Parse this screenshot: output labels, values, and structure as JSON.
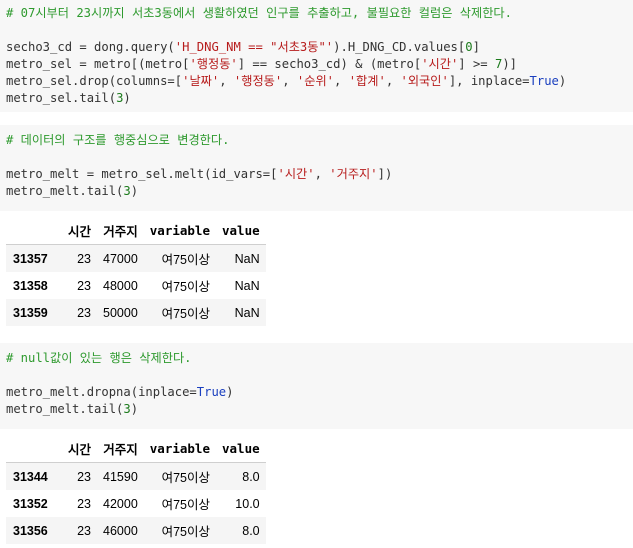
{
  "cell1": {
    "comment": "# 07시부터 23시까지 서초3동에서 생활하였던 인구를 추출하고, 불필요한 컬럼은 삭제한다.",
    "line1_a": "secho3_cd = dong.query(",
    "line1_str": "'H_DNG_NM == \"서초3동\"'",
    "line1_b": ").H_DNG_CD.values[",
    "line1_num": "0",
    "line1_c": "]",
    "line2_a": "metro_sel = metro[(metro[",
    "line2_str1": "'행정동'",
    "line2_b": "] == secho3_cd) & (metro[",
    "line2_str2": "'시간'",
    "line2_c": "] >= ",
    "line2_num": "7",
    "line2_d": ")]",
    "line3_a": "metro_sel.drop(columns=[",
    "line3_s1": "'날짜'",
    "line3_s2": "'행정동'",
    "line3_s3": "'순위'",
    "line3_s4": "'합계'",
    "line3_s5": "'외국인'",
    "line3_b": "], inplace=",
    "line3_kw": "True",
    "line3_c": ")",
    "line4_a": "metro_sel.tail(",
    "line4_num": "3",
    "line4_b": ")"
  },
  "cell2": {
    "comment": "# 데이터의 구조를 행중심으로 변경한다.",
    "line1_a": "metro_melt = metro_sel.melt(id_vars=[",
    "line1_s1": "'시간'",
    "line1_s2": "'거주지'",
    "line1_b": "])",
    "line2_a": "metro_melt.tail(",
    "line2_num": "3",
    "line2_b": ")"
  },
  "table1": {
    "headers": [
      "",
      "시간",
      "거주지",
      "variable",
      "value"
    ],
    "rows": [
      [
        "31357",
        "23",
        "47000",
        "여75이상",
        "NaN"
      ],
      [
        "31358",
        "23",
        "48000",
        "여75이상",
        "NaN"
      ],
      [
        "31359",
        "23",
        "50000",
        "여75이상",
        "NaN"
      ]
    ]
  },
  "cell3": {
    "comment": "# null값이 있는 행은 삭제한다.",
    "line1_a": "metro_melt.dropna(inplace=",
    "line1_kw": "True",
    "line1_b": ")",
    "line2_a": "metro_melt.tail(",
    "line2_num": "3",
    "line2_b": ")"
  },
  "table2": {
    "headers": [
      "",
      "시간",
      "거주지",
      "variable",
      "value"
    ],
    "rows": [
      [
        "31344",
        "23",
        "41590",
        "여75이상",
        "8.0"
      ],
      [
        "31352",
        "23",
        "42000",
        "여75이상",
        "10.0"
      ],
      [
        "31356",
        "23",
        "46000",
        "여75이상",
        "8.0"
      ]
    ]
  },
  "colors": {
    "comment": "#2e9a2e",
    "string": "#b71c1c",
    "keyword": "#1a3fbf",
    "number": "#1b7a1b",
    "cell_bg": "#f7f7f7"
  }
}
